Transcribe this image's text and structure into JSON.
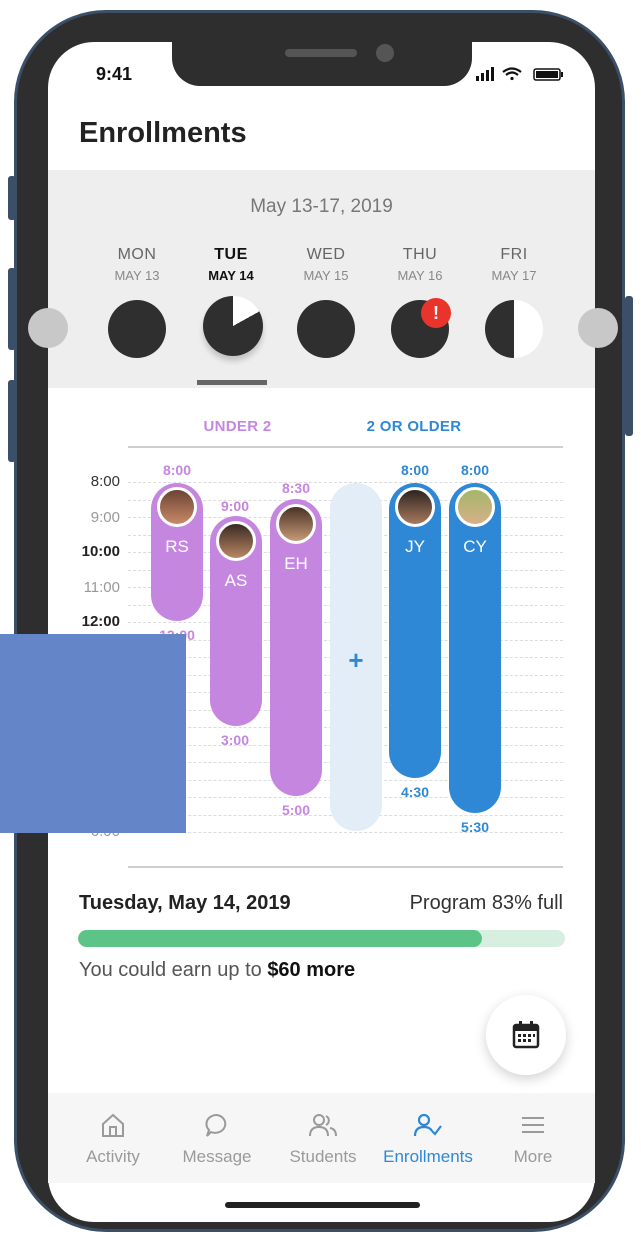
{
  "status": {
    "time": "9:41"
  },
  "header": {
    "title": "Enrollments"
  },
  "week": {
    "range": "May 13-17, 2019",
    "days": [
      {
        "name": "MON",
        "date": "MAY 13",
        "fill": 1.0
      },
      {
        "name": "TUE",
        "date": "MAY 14",
        "fill": 0.83,
        "selected": true
      },
      {
        "name": "WED",
        "date": "MAY 15",
        "fill": 1.0
      },
      {
        "name": "THU",
        "date": "MAY 16",
        "fill": 1.0,
        "alert": "!"
      },
      {
        "name": "FRI",
        "date": "MAY 17",
        "fill": 0.5
      }
    ]
  },
  "schedule": {
    "groups": {
      "under2": "UNDER 2",
      "older": "2 OR OLDER"
    },
    "hours": [
      "8:00",
      "9:00",
      "10:00",
      "11:00",
      "12:00",
      "6:00"
    ],
    "children": [
      {
        "initials": "RS",
        "start": "8:00",
        "end": "12:00",
        "group": "under2"
      },
      {
        "initials": "AS",
        "start": "9:00",
        "end": "3:00",
        "group": "under2"
      },
      {
        "initials": "EH",
        "start": "8:30",
        "end": "5:00",
        "group": "under2"
      },
      {
        "initials": "JY",
        "start": "8:00",
        "end": "4:30",
        "group": "older"
      },
      {
        "initials": "CY",
        "start": "8:00",
        "end": "5:30",
        "group": "older"
      }
    ],
    "add_symbol": "+"
  },
  "summary": {
    "date": "Tuesday, May 14, 2019",
    "full_text": "Program 83% full",
    "progress": 0.83,
    "earn_prefix": "You could earn up to ",
    "earn_amount": "$60 more"
  },
  "tabs": [
    {
      "label": "Activity",
      "icon": "home-icon"
    },
    {
      "label": "Message",
      "icon": "message-icon"
    },
    {
      "label": "Students",
      "icon": "students-icon"
    },
    {
      "label": "Enrollments",
      "icon": "enrollments-icon",
      "active": true
    },
    {
      "label": "More",
      "icon": "menu-icon"
    }
  ],
  "colors": {
    "purple": "#c586e0",
    "blue": "#2f88d6",
    "green": "#5cc487",
    "alert": "#e9342b"
  }
}
